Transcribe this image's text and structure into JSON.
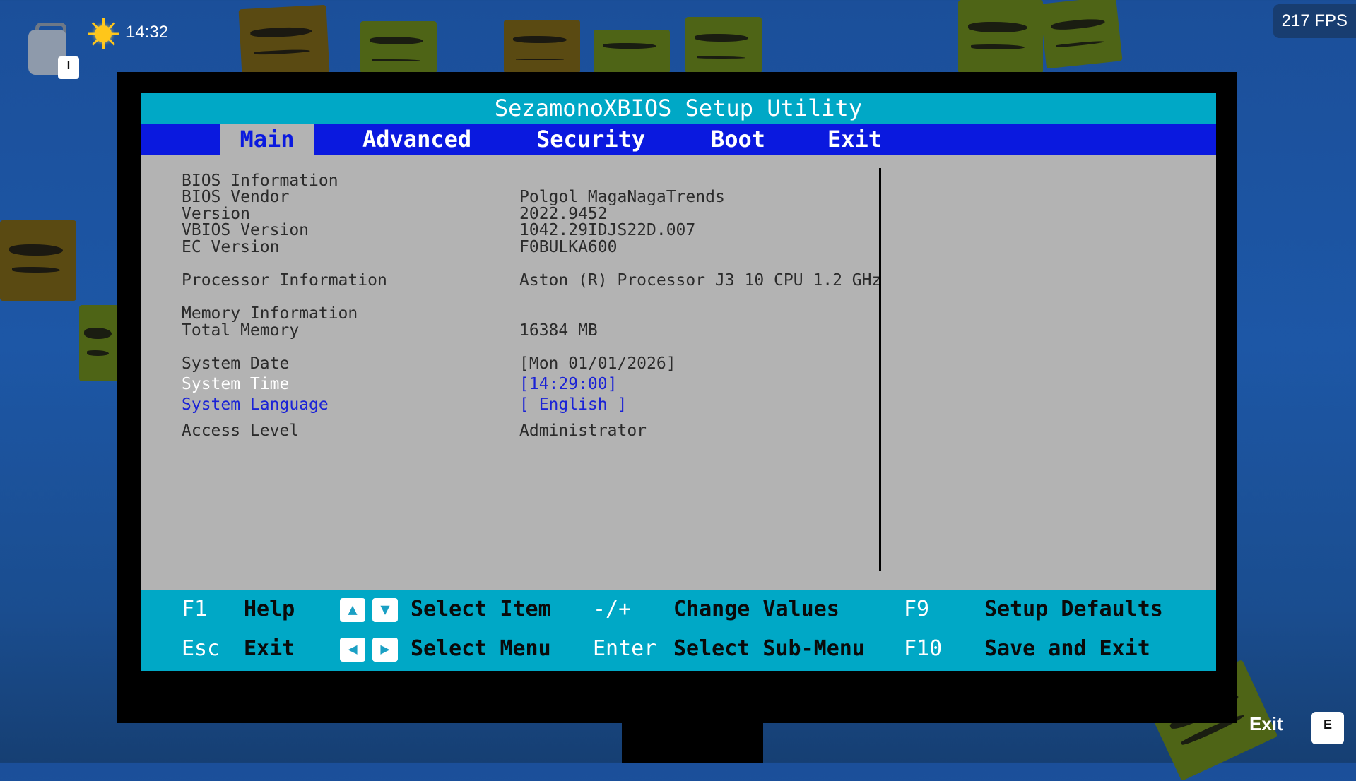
{
  "hud": {
    "backpack_key": "I",
    "time": "14:32",
    "fps": "217 FPS",
    "exit_label": "Exit",
    "exit_key": "E"
  },
  "bios": {
    "title": "SezamonoXBIOS Setup Utility",
    "tabs": [
      "Main",
      "Advanced",
      "Security",
      "Boot",
      "Exit"
    ],
    "active_tab": "Main",
    "rows": [
      {
        "label": "BIOS Information",
        "value": ""
      },
      {
        "label": "BIOS Vendor",
        "value": "Polgol MagaNagaTrends"
      },
      {
        "label": "Version",
        "value": "2022.9452"
      },
      {
        "label": "VBIOS Version",
        "value": "1042.29IDJS22D.007"
      },
      {
        "label": "EC Version",
        "value": "F0BULKA600"
      },
      {
        "label": "Processor Information",
        "value": "Aston (R) Processor J3 10 CPU 1.2 GHz"
      },
      {
        "label": "Memory Information",
        "value": ""
      },
      {
        "label": "Total Memory",
        "value": "16384 MB"
      },
      {
        "label": "System Date",
        "value": "[Mon 01/01/2026]"
      },
      {
        "label": "System Time",
        "value": "[14:29:00]"
      },
      {
        "label": "System Language",
        "value": "[ English ]"
      },
      {
        "label": "Access Level",
        "value": "Administrator"
      }
    ],
    "footer": {
      "f1_key": "F1",
      "f1_desc": "Help",
      "esc_key": "Esc",
      "esc_desc": "Exit",
      "select_item": "Select Item",
      "select_menu": "Select Menu",
      "plusminus_key": "-/+",
      "plusminus_desc": "Change Values",
      "enter_key": "Enter",
      "enter_desc": "Select Sub-Menu",
      "f9_key": "F9",
      "f9_desc": "Setup Defaults",
      "f10_key": "F10",
      "f10_desc": "Save and Exit"
    }
  },
  "colors": {
    "title_bg": "#00a8c6",
    "menu_bg": "#0a19df",
    "panel_bg": "#b3b3b3",
    "highlight_blue": "#1a22d6"
  }
}
